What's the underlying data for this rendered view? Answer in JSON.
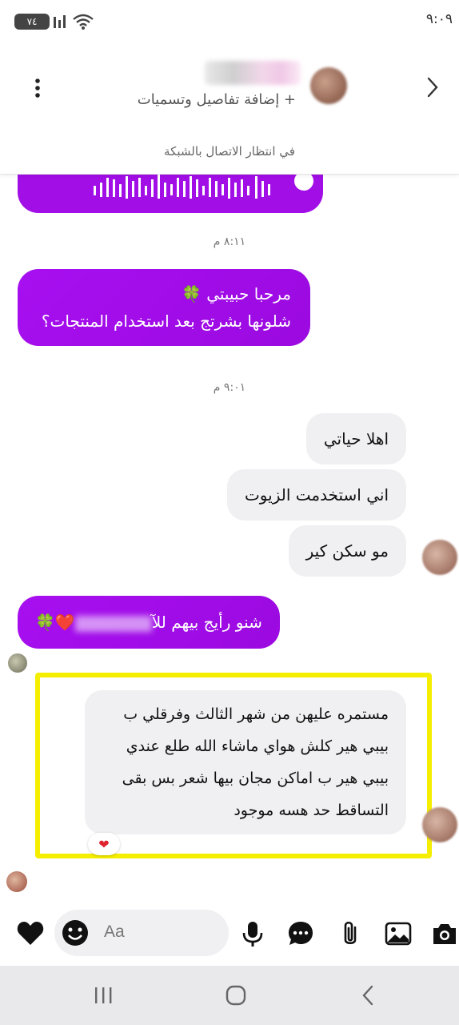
{
  "status_bar": {
    "time": "٩:٠٩",
    "battery": "٧٤"
  },
  "header": {
    "subtitle": "+ إضافة تفاصيل وتسميات",
    "connection_status": "في انتظار الاتصال بالشبكة"
  },
  "messages": {
    "timestamp_1": "٨:١١ م",
    "out_1_line1": "مرحبا حبيبتي 🍀",
    "out_1_line2": "شلونها بشرتج بعد استخدام المنتجات؟",
    "timestamp_2": "٩:٠١ م",
    "in_1": "اهلا حياتي",
    "in_2": "اني استخدمت الزيوت",
    "in_3": "مو سكن كير",
    "out_2_prefix": "شنو رأيج بيهم للآ",
    "out_2_suffix": "❤️🍀",
    "in_4_line1": "مستمره عليهن من شهر الثالث وفرقلي ب",
    "in_4_line2": "بيبي هير كلش هواي ماشاء الله طلع عندي",
    "in_4_line3": "بيبي هير ب اماكن مجان بيها شعر بس بقى",
    "in_4_line4": "التساقط حد هسه موجود",
    "reaction": "❤"
  },
  "composer": {
    "placeholder": "Aa"
  },
  "colors": {
    "outgoing_bubble": "#a20ee6",
    "incoming_bubble": "#f0f0f2",
    "highlight": "#f5ee00"
  }
}
